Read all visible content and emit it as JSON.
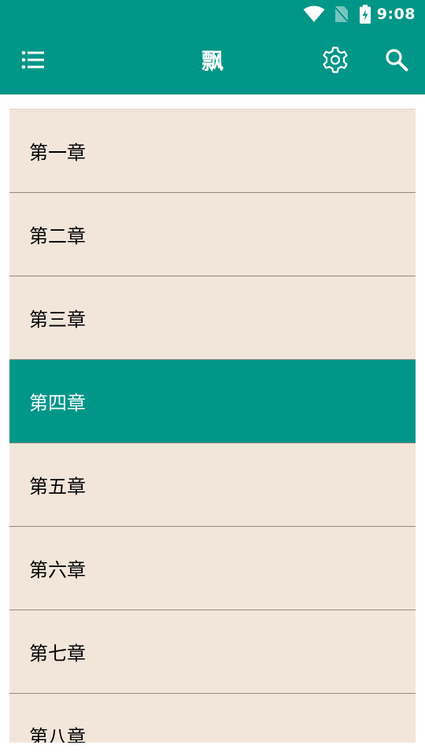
{
  "status_bar": {
    "time": "9:08",
    "icons": [
      "wifi-icon",
      "no-sim-icon",
      "battery-charging-icon"
    ]
  },
  "app_bar": {
    "title": "飘",
    "left_icon": "menu-list-icon",
    "right_icons": [
      "gear-icon",
      "search-icon"
    ]
  },
  "colors": {
    "primary": "#009688",
    "list_background": "#f2e6da",
    "divider": "#8e8a86"
  },
  "chapters": {
    "selected_index": 3,
    "items": [
      {
        "label": "第一章"
      },
      {
        "label": "第二章"
      },
      {
        "label": "第三章"
      },
      {
        "label": "第四章"
      },
      {
        "label": "第五章"
      },
      {
        "label": "第六章"
      },
      {
        "label": "第七章"
      },
      {
        "label": "第八章"
      }
    ]
  }
}
